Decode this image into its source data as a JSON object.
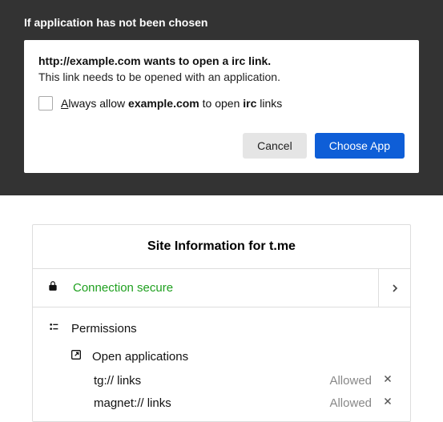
{
  "top": {
    "note": "If application has not been chosen",
    "dialog": {
      "title_prefix": "http://example.com",
      "title_suffix": " wants to open a irc link.",
      "subtitle": "This link needs to be opened with an application.",
      "checkbox_label_parts": {
        "a_letter": "A",
        "lways": "lways allow ",
        "domain": "example.com",
        "mid": " to open ",
        "protocol": "irc",
        "end": " links"
      },
      "cancel": "Cancel",
      "choose": "Choose App"
    }
  },
  "siteinfo": {
    "title_prefix": "Site Information for ",
    "title_host": "t.me",
    "connection": "Connection secure",
    "permissions_label": "Permissions",
    "open_apps_label": "Open applications",
    "items": [
      {
        "name": "tg:// links",
        "status": "Allowed"
      },
      {
        "name": "magnet:// links",
        "status": "Allowed"
      }
    ]
  }
}
